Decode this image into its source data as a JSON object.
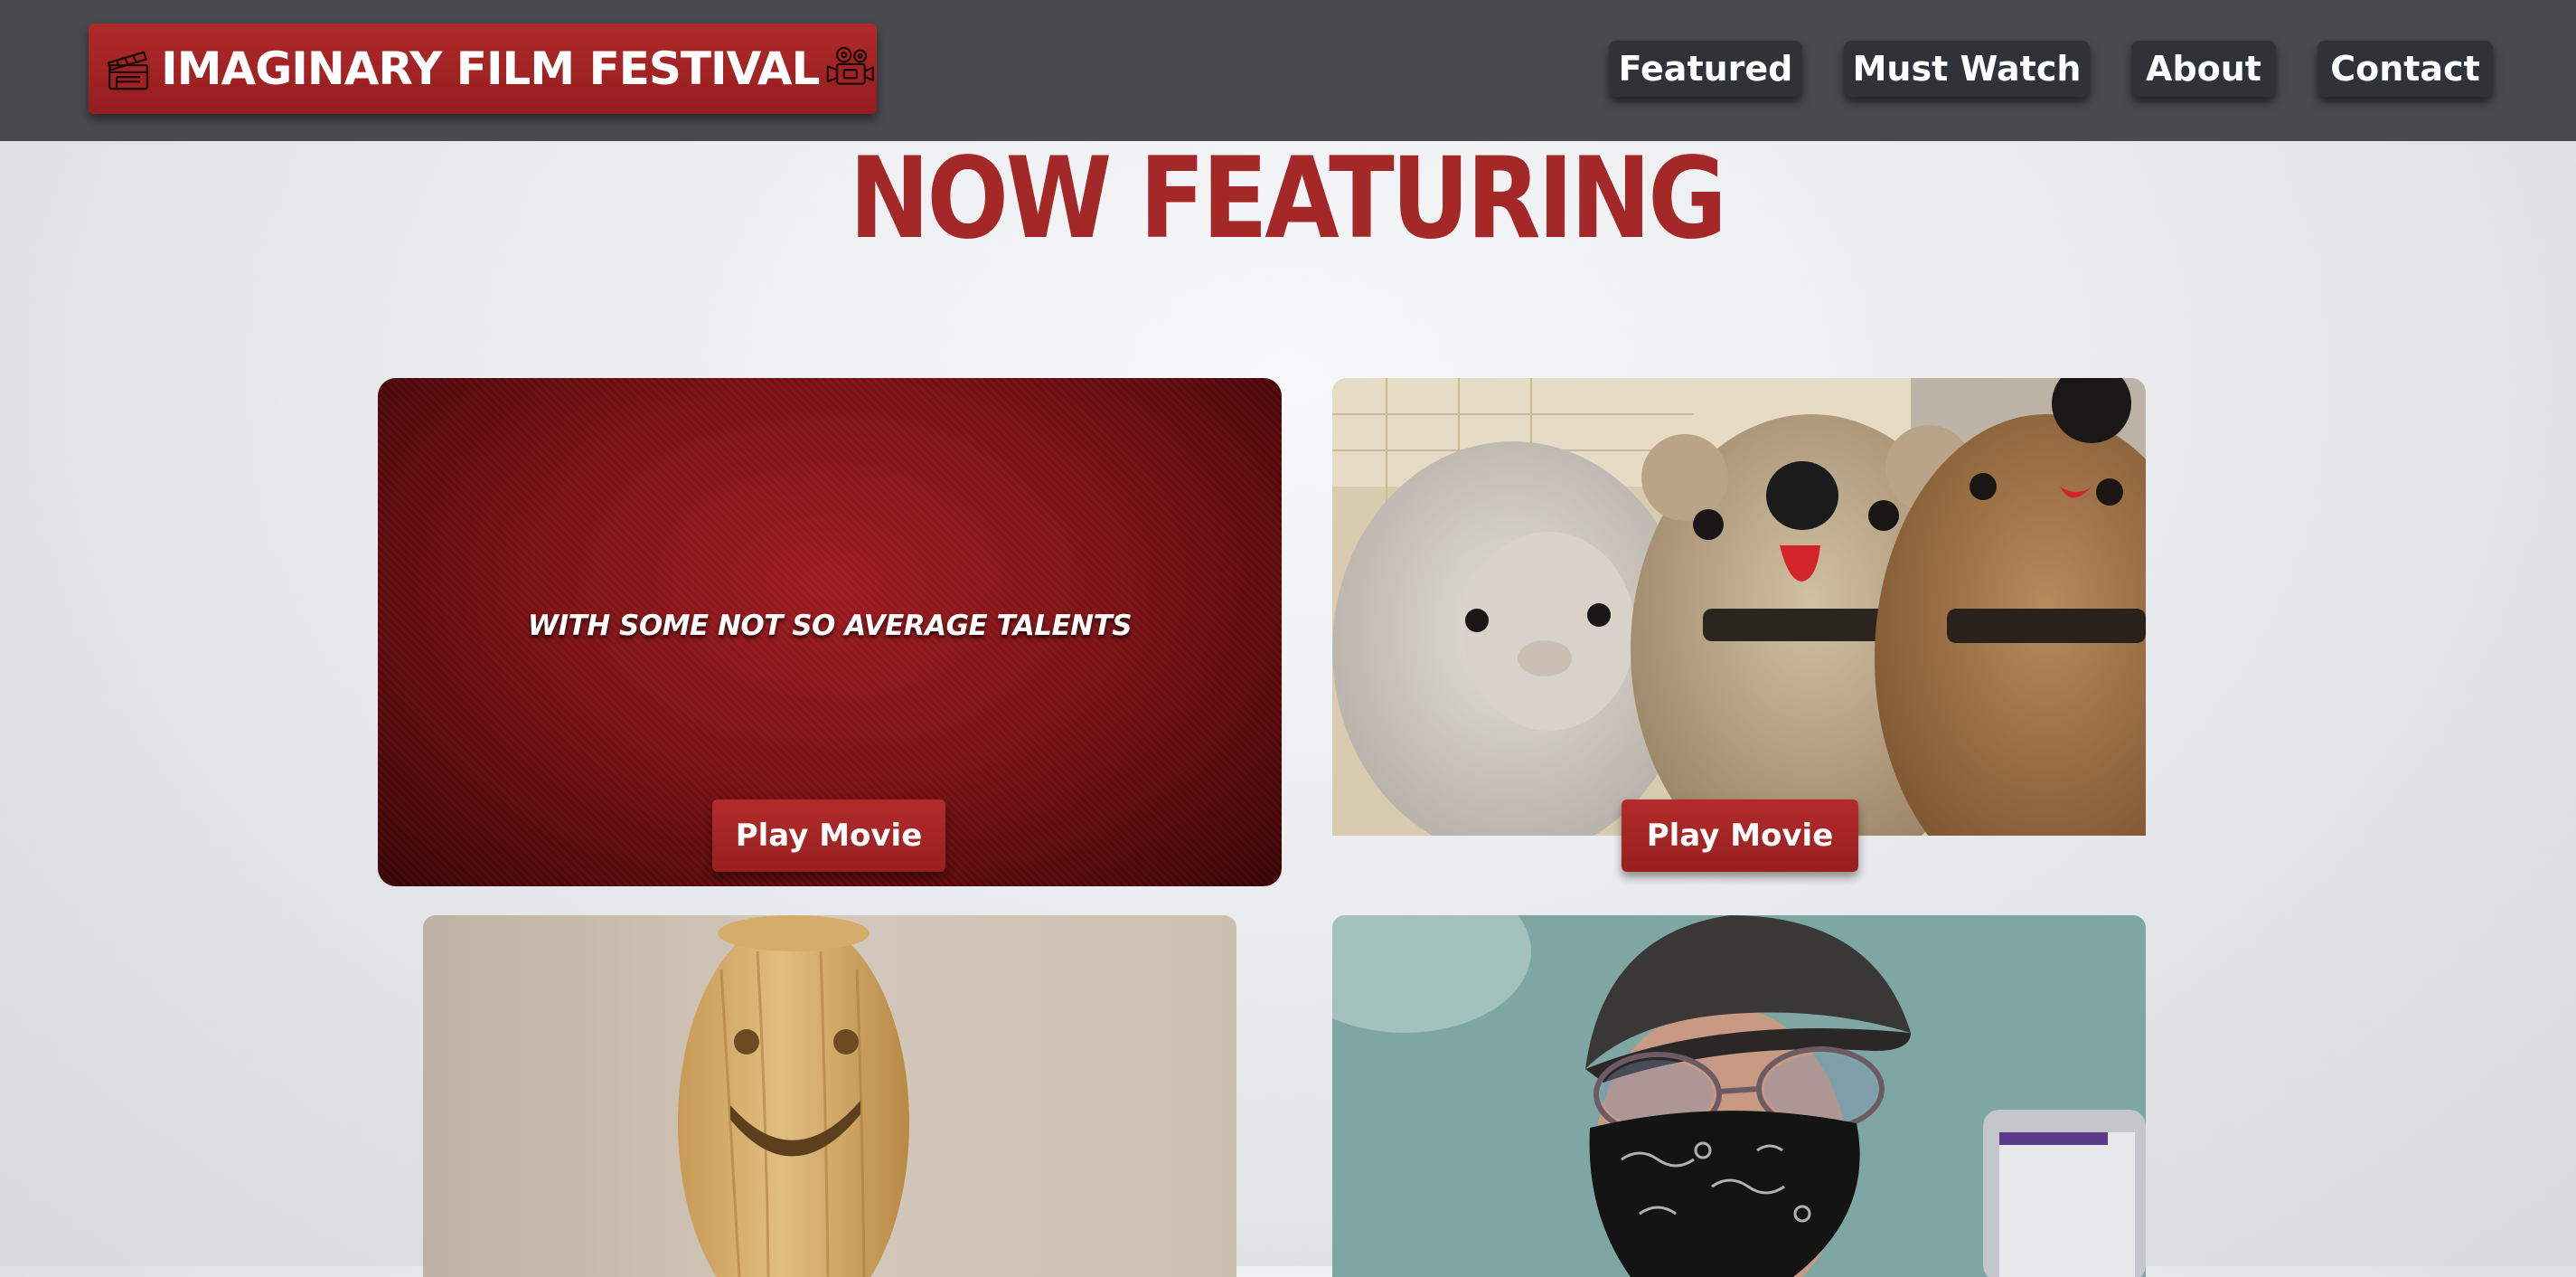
{
  "header": {
    "brand_title": "IMAGINARY FILM FESTIVAL",
    "brand_icons": [
      "clapperboard-icon",
      "movie-camera-icon"
    ],
    "nav": [
      {
        "label": "Featured"
      },
      {
        "label": "Must Watch"
      },
      {
        "label": "About"
      },
      {
        "label": "Contact"
      }
    ]
  },
  "main": {
    "heading": "NOW FEATURING",
    "cards": [
      {
        "tagline": "WITH SOME NOT SO AVERAGE TALENTS",
        "button_label": "Play Movie"
      },
      {
        "button_label": "Play Movie"
      },
      {},
      {}
    ]
  },
  "colors": {
    "header_bg": "#474a4f",
    "brand_red": "#a52828",
    "nav_button_bg": "#2f3236",
    "page_bg": "#e9ebee"
  }
}
